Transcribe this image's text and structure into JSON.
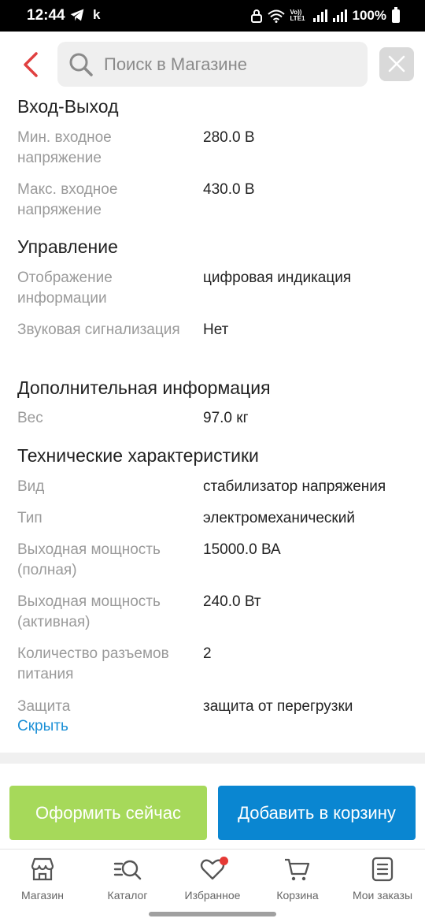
{
  "status_bar": {
    "time": "12:44",
    "left_icons": [
      "telegram-icon",
      "k-icon"
    ],
    "k_glyph": "k",
    "volte": "Vo)) LTE1",
    "battery": "100%"
  },
  "header": {
    "search_placeholder": "Поиск в Магазине"
  },
  "sections": {
    "io": {
      "title": "Вход-Выход",
      "rows": [
        {
          "label": "Мин. входное напряжение",
          "value": "280.0 В"
        },
        {
          "label": "Макс. входное напряжение",
          "value": "430.0 В"
        }
      ]
    },
    "control": {
      "title": "Управление",
      "rows": [
        {
          "label": "Отображение информации",
          "value": "цифровая индикация"
        },
        {
          "label": "Звуковая сигнализация",
          "value": "Нет"
        }
      ]
    },
    "extra": {
      "title": "Дополнительная информация",
      "rows": [
        {
          "label": "Вес",
          "value": "97.0 кг"
        }
      ]
    },
    "tech": {
      "title": "Технические характеристики",
      "rows": [
        {
          "label": "Вид",
          "value": "стабилизатор напряжения"
        },
        {
          "label": "Тип",
          "value": "электромеханический"
        },
        {
          "label": "Выходная мощность (полная)",
          "value": "15000.0 ВА"
        },
        {
          "label": "Выходная мощность (активная)",
          "value": "240.0 Вт"
        },
        {
          "label": "Количество разъемов питания",
          "value": "2"
        },
        {
          "label": "Защита",
          "value": "защита от перегрузки"
        }
      ]
    }
  },
  "hide_link": "Скрыть",
  "actions": {
    "order_now": "Оформить сейчас",
    "add_to_cart": "Добавить в корзину"
  },
  "tabbar": {
    "items": [
      {
        "label": "Магазин",
        "icon": "store-icon"
      },
      {
        "label": "Каталог",
        "icon": "catalog-search-icon"
      },
      {
        "label": "Избранное",
        "icon": "heart-icon"
      },
      {
        "label": "Корзина",
        "icon": "cart-icon"
      },
      {
        "label": "Мои заказы",
        "icon": "orders-icon"
      }
    ]
  },
  "colors": {
    "accent_blue": "#0a86d1",
    "order_green": "#a6d95a",
    "back_red": "#e04040",
    "badge_red": "#e53935"
  }
}
